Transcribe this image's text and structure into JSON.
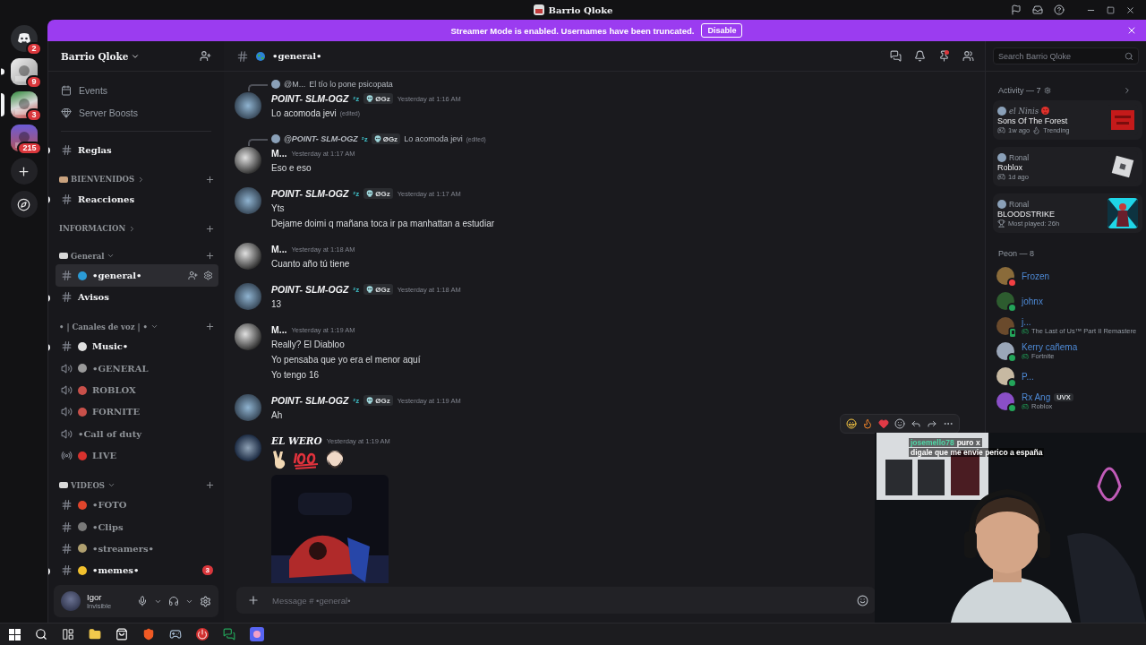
{
  "window": {
    "title": "Barrio Qloke"
  },
  "servers": [
    {
      "kind": "home",
      "badge": "2"
    },
    {
      "kind": "server",
      "badge": "9",
      "unread": true
    },
    {
      "kind": "server",
      "badge": "3",
      "selected": true
    },
    {
      "kind": "server",
      "badge": "215"
    },
    {
      "kind": "add"
    },
    {
      "kind": "discover"
    }
  ],
  "banner": {
    "text": "Streamer Mode is enabled. Usernames have been truncated.",
    "button": "Disable"
  },
  "sidebar": {
    "server_name": "Barrio Qloke",
    "shortcuts": [
      {
        "kind": "events",
        "label": "Events"
      },
      {
        "kind": "boosts",
        "label": "Server Boosts"
      }
    ],
    "channels": [
      {
        "kind": "text",
        "name": "Reglas",
        "unread": true,
        "selected": false
      },
      {
        "kind": "category",
        "name": "BIENVENIDOS",
        "expanded": false,
        "color": "#c9a27e"
      },
      {
        "kind": "text",
        "name": "Reacciones",
        "unread": true,
        "selected": false
      },
      {
        "kind": "category",
        "name": "INFORMACION",
        "expanded": false
      },
      {
        "kind": "category",
        "name": "General",
        "expanded": true,
        "color": "#d8d8d8"
      },
      {
        "kind": "text",
        "name": "•general•",
        "unread": false,
        "selected": true,
        "color": "#2b9bd6"
      },
      {
        "kind": "text",
        "name": "Avisos",
        "unread": true,
        "selected": false
      },
      {
        "kind": "category",
        "name": "• | Canales de voz | •",
        "expanded": true
      },
      {
        "kind": "text",
        "name": "Music•",
        "unread": true,
        "selected": false,
        "color": "#e0e0e0"
      },
      {
        "kind": "voice",
        "name": "•GENERAL",
        "color": "#9a9a9a"
      },
      {
        "kind": "voice",
        "name": "ROBLOX",
        "color": "#c8504a"
      },
      {
        "kind": "voice",
        "name": "FORNITE",
        "color": "#c8504a"
      },
      {
        "kind": "voice",
        "name": "•Call of duty"
      },
      {
        "kind": "stage",
        "name": "LIVE",
        "color": "#d8322e"
      },
      {
        "kind": "category",
        "name": "VIDEOS",
        "expanded": true,
        "color": "#d8d8d8"
      },
      {
        "kind": "text",
        "name": "•FOTO",
        "unread": false,
        "selected": false,
        "color": "#e0452c"
      },
      {
        "kind": "text",
        "name": "•Clips",
        "unread": false,
        "selected": false,
        "color": "#7a7a7a"
      },
      {
        "kind": "text",
        "name": "•streamers•",
        "unread": false,
        "selected": false,
        "color": "#b0a070"
      },
      {
        "kind": "text",
        "name": "•memes•",
        "unread": true,
        "selected": false,
        "color": "#f2c12e",
        "badge": "3"
      }
    ]
  },
  "user": {
    "name": "Igor",
    "status": "Invisible"
  },
  "chat": {
    "channel": "•general•",
    "messages": [
      {
        "kind": "text",
        "author": "POINT- SLM-OGZ",
        "suffix": "ᶻz",
        "tag": "ØGz",
        "time": "Yesterday at 1:16 AM",
        "reply": {
          "mention": "@M...",
          "text": "El tío lo pone psicopata"
        },
        "lines": [
          "Lo acomoda jevi"
        ],
        "edited": "(edited)"
      },
      {
        "kind": "text",
        "author": "M...",
        "time": "Yesterday at 1:17 AM",
        "reply": {
          "mention": "@POINT- SLM-OGZ",
          "suffix": "ᶻz",
          "tag": "ØGz",
          "text": "Lo acomoda jevi",
          "edited": "(edited)"
        },
        "lines": [
          "Eso e eso"
        ]
      },
      {
        "kind": "text",
        "author": "POINT- SLM-OGZ",
        "suffix": "ᶻz",
        "tag": "ØGz",
        "time": "Yesterday at 1:17 AM",
        "lines": [
          "Yts",
          "Dejame doimi q mañana toca ir pa manhattan a estudiar"
        ]
      },
      {
        "kind": "text",
        "author": "M...",
        "time": "Yesterday at 1:18 AM",
        "lines": [
          "Cuanto año tú tiene"
        ]
      },
      {
        "kind": "text",
        "author": "POINT- SLM-OGZ",
        "suffix": "ᶻz",
        "tag": "ØGz",
        "time": "Yesterday at 1:18 AM",
        "lines": [
          "13"
        ]
      },
      {
        "kind": "text",
        "author": "M...",
        "time": "Yesterday at 1:19 AM",
        "lines": [
          "Really? El Diabloo",
          "Yo pensaba que yo era el menor aquí",
          "Yo tengo 16"
        ]
      },
      {
        "kind": "text",
        "author": "POINT- SLM-OGZ",
        "suffix": "ᶻz",
        "tag": "ØGz",
        "time": "Yesterday at 1:19 AM",
        "lines": [
          "Ah"
        ]
      },
      {
        "kind": "media",
        "author": "EL WERO",
        "time": "Yesterday at 1:19 AM"
      }
    ],
    "composer": {
      "placeholder": "Message # •general•"
    }
  },
  "members": {
    "search": {
      "placeholder": "Search Barrio Qloke"
    },
    "activity_title": "Activity — 7",
    "activities": [
      {
        "user": "el Ninis",
        "game": "Sons Of The Forest",
        "meta": [
          {
            "kind": "game",
            "text": "1w ago"
          },
          {
            "kind": "trending",
            "text": "Trending"
          }
        ]
      },
      {
        "user": "Ronal",
        "game": "Roblox",
        "meta": [
          {
            "kind": "game",
            "text": "1d ago"
          }
        ]
      },
      {
        "user": "Ronal",
        "game": "BLOODSTRIKE",
        "meta": [
          {
            "kind": "trophy",
            "text": "Most played: 26h"
          }
        ]
      }
    ],
    "group_title": "Peon — 8",
    "list": [
      {
        "name": "Frozen",
        "color": "#f23f43",
        "mobile": false
      },
      {
        "name": "johnx",
        "color": "#23a55a",
        "mobile": false
      },
      {
        "name": "j...",
        "color": "#23a55a",
        "mobile": true,
        "activity": "The Last of Us™ Part II Remastere"
      },
      {
        "name": "Kerry cañema",
        "color": "#23a55a",
        "mobile": false,
        "activity": "Fortnite"
      },
      {
        "name": "P...",
        "color": "#23a55a",
        "mobile": false
      },
      {
        "name": "Rx Ang",
        "color": "#23a55a",
        "mobile": false,
        "tag": "UVX",
        "activity": "Roblox"
      }
    ]
  },
  "stream": {
    "chat": [
      {
        "user": "josemello78",
        "text": "puro x"
      },
      {
        "text": "digale que me envie perico a españa"
      }
    ]
  }
}
